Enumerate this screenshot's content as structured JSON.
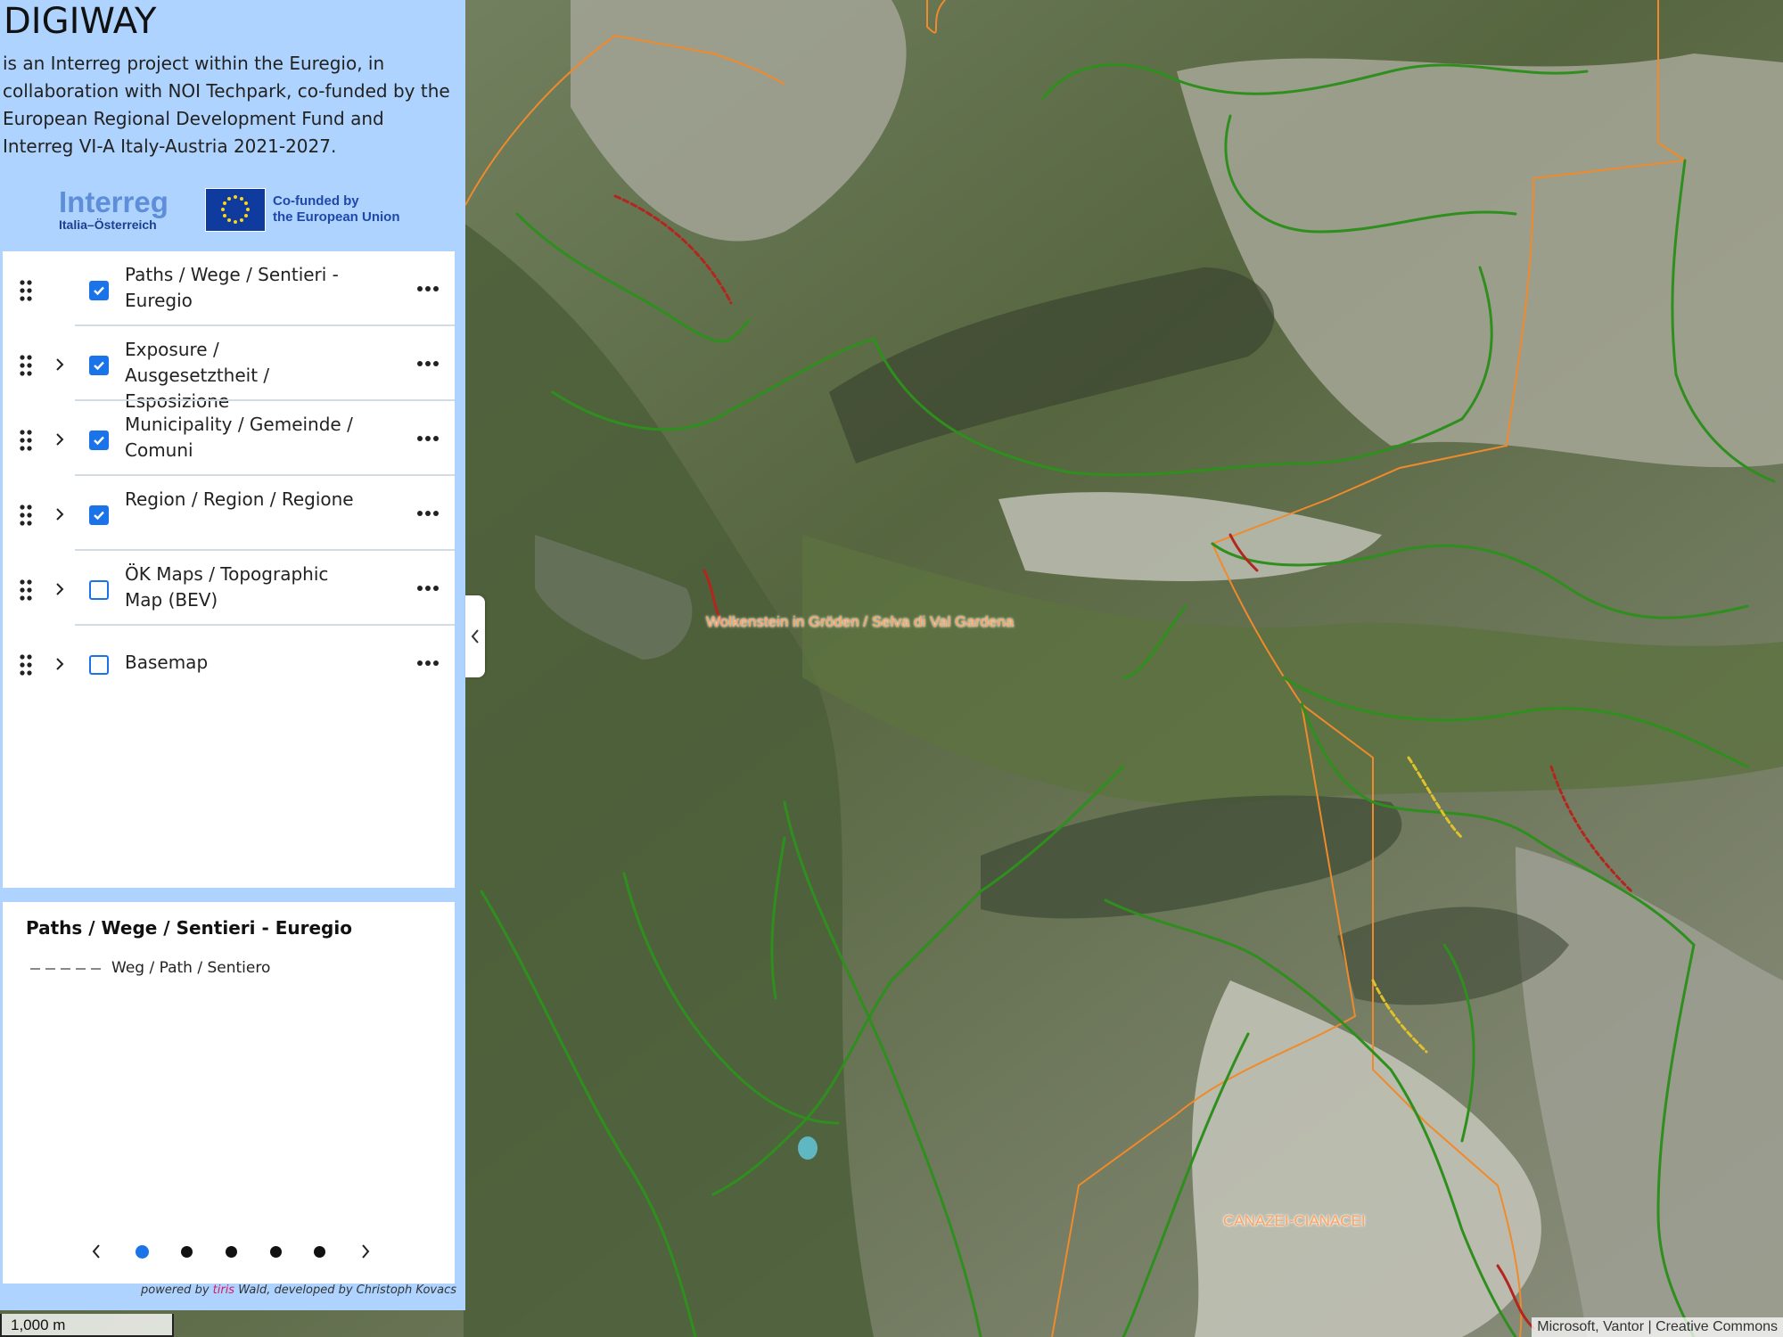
{
  "app": {
    "title": "DIGIWAY",
    "description": "is an Interreg project within the Euregio, in collaboration with NOI Techpark, co-funded by the European Regional Development Fund and Interreg VI-A Italy-Austria 2021-2027."
  },
  "logos": {
    "interreg_word": "Interreg",
    "interreg_sub": "Italia–Österreich",
    "eu_line1": "Co-funded by",
    "eu_line2": "the European Union"
  },
  "layers": [
    {
      "label": "Paths / Wege / Sentieri - Euregio",
      "checked": true,
      "expandable": false
    },
    {
      "label": "Exposure / Ausgesetztheit / Esposizione",
      "checked": true,
      "expandable": true
    },
    {
      "label": "Municipality / Gemeinde / Comuni",
      "checked": true,
      "expandable": true
    },
    {
      "label": "Region / Region / Regione",
      "checked": true,
      "expandable": true
    },
    {
      "label": "ÖK Maps / Topographic Map (BEV)",
      "checked": false,
      "expandable": true
    },
    {
      "label": "Basemap",
      "checked": false,
      "expandable": true
    }
  ],
  "legend": {
    "title": "Paths / Wege / Sentieri - Euregio",
    "item_label": "Weg / Path / Sentiero",
    "pages": 5,
    "active_page": 1
  },
  "footer": {
    "powered_prefix": "powered by ",
    "powered_brand": "tiris",
    "powered_suffix": " Wald, developed by Christoph Kovacs"
  },
  "map": {
    "labels": {
      "wolkenstein": "Wolkenstein in Gröden / Selva di Val Gardena",
      "canazei": "CANAZEI-CIANACEI"
    },
    "attribution": "Microsoft, Vantor | Creative Commons",
    "scale_label": "1,000 m"
  },
  "colors": {
    "sidebar_bg": "#aed3ff",
    "accent": "#1a73e8",
    "path_green": "#2e8b1e",
    "border_orange": "#f08a2a"
  }
}
